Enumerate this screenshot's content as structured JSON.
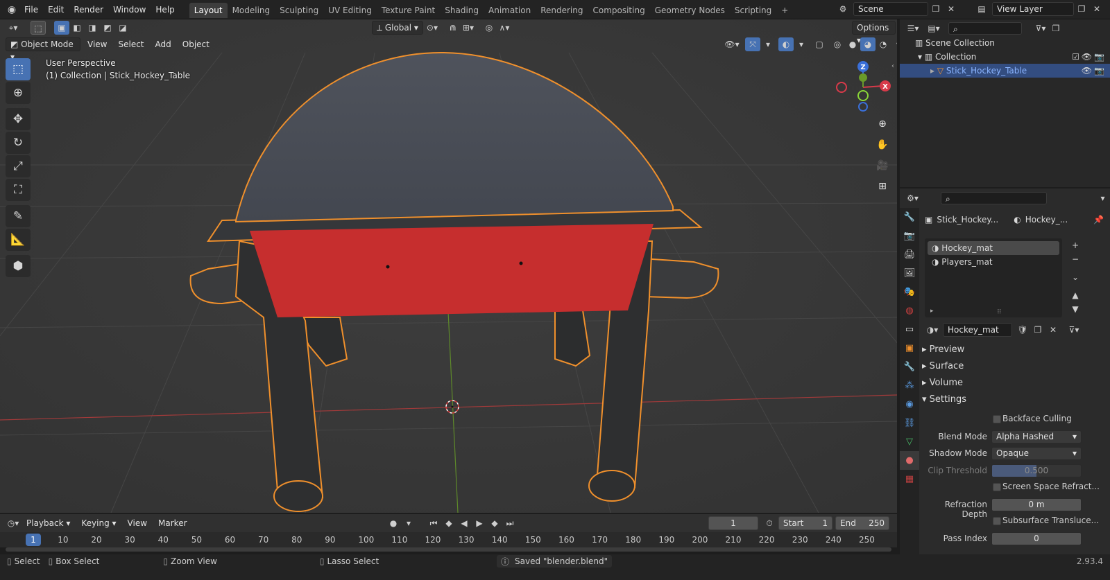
{
  "topbar": {
    "menus": [
      "File",
      "Edit",
      "Render",
      "Window",
      "Help"
    ],
    "workspaces": [
      "Layout",
      "Modeling",
      "Sculpting",
      "UV Editing",
      "Texture Paint",
      "Shading",
      "Animation",
      "Rendering",
      "Compositing",
      "Geometry Nodes",
      "Scripting"
    ],
    "active_workspace": "Layout",
    "add_tab": "+",
    "scene_label": "Scene",
    "view_layer_label": "View Layer"
  },
  "viewport": {
    "transform_orientation": "Global",
    "options_label": "Options",
    "mode": "Object Mode",
    "menus": [
      "View",
      "Select",
      "Add",
      "Object"
    ],
    "perspective_label": "User Perspective",
    "collection_label": "(1) Collection | Stick_Hockey_Table",
    "gizmo_axes": {
      "x": "X",
      "y": "Y",
      "z": "Z"
    },
    "colors": {
      "background": "#393939",
      "x_axis": "#c0392b",
      "y_axis": "#6a9a2a",
      "selection_outline": "#f0902c",
      "table_red": "#c62e2e"
    }
  },
  "timeline": {
    "menus": [
      "Playback",
      "Keying",
      "View",
      "Marker"
    ],
    "current_frame": "1",
    "start_label": "Start",
    "start_value": "1",
    "end_label": "End",
    "end_value": "250",
    "ticks": [
      "1",
      "10",
      "20",
      "30",
      "40",
      "50",
      "60",
      "70",
      "80",
      "90",
      "100",
      "110",
      "120",
      "130",
      "140",
      "150",
      "160",
      "170",
      "180",
      "190",
      "200",
      "210",
      "220",
      "230",
      "240",
      "250"
    ]
  },
  "statusbar": {
    "select": "Select",
    "box_select": "Box Select",
    "zoom_view": "Zoom View",
    "lasso_select": "Lasso Select",
    "message": "Saved \"blender.blend\"",
    "version": "2.93.4"
  },
  "outliner": {
    "scene_collection": "Scene Collection",
    "collection": "Collection",
    "object": "Stick_Hockey_Table"
  },
  "properties": {
    "object_name": "Stick_Hockey...",
    "material_short": "Hockey_...",
    "slots": [
      "Hockey_mat",
      "Players_mat"
    ],
    "material_name": "Hockey_mat",
    "panels": {
      "preview": "Preview",
      "surface": "Surface",
      "volume": "Volume",
      "settings": "Settings"
    },
    "settings": {
      "backface_culling": "Backface Culling",
      "blend_mode_label": "Blend Mode",
      "blend_mode_value": "Alpha Hashed",
      "shadow_mode_label": "Shadow Mode",
      "shadow_mode_value": "Opaque",
      "clip_threshold_label": "Clip Threshold",
      "clip_threshold_value": "0.500",
      "screen_space_refraction": "Screen Space Refract...",
      "refraction_depth_label": "Refraction Depth",
      "refraction_depth_value": "0 m",
      "subsurface_translucency": "Subsurface Transluce...",
      "pass_index_label": "Pass Index",
      "pass_index_value": "0"
    }
  }
}
